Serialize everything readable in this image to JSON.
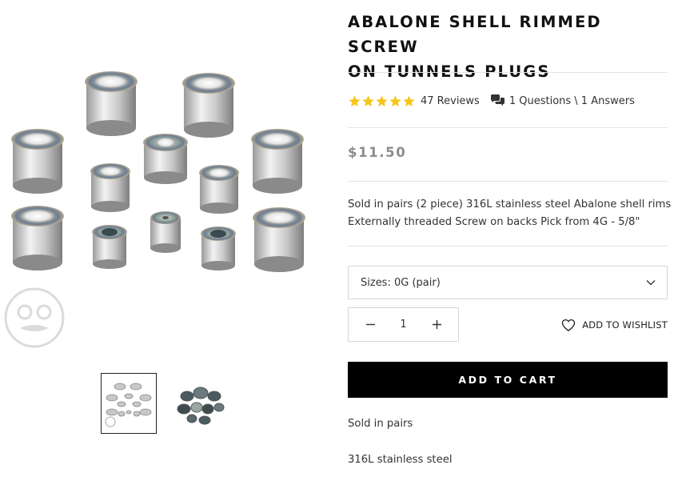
{
  "product": {
    "title_line1": "ABALONE SHELL RIMMED SCREW",
    "title_line2": "ON TUNNELS PLUGS",
    "rating": 5,
    "reviews_label": "47 Reviews",
    "qa_label": "1 Questions \\ 1 Answers",
    "price": "$11.50",
    "description_line1": "Sold in pairs (2 piece) 316L stainless steel Abalone shell rims",
    "description_line2": "Externally threaded Screw on backs Pick from 4G - 5/8\""
  },
  "options": {
    "size_label": "Sizes: 0G (pair)",
    "quantity": "1"
  },
  "actions": {
    "wishlist_label": "ADD TO WISHLIST",
    "add_to_cart_label": "ADD TO CART"
  },
  "features": [
    "Sold in pairs",
    "316L stainless steel"
  ],
  "gallery": {
    "thumbnail_count": 2,
    "active_thumbnail": 1
  },
  "colors": {
    "star": "#f5c518",
    "button_bg": "#000000",
    "price": "#8c8c8c",
    "divider": "#e3e3e3"
  },
  "icons": {
    "star": "star-icon",
    "questions": "chat-bubbles-icon",
    "dropdown": "chevron-down-icon",
    "minus": "minus-icon",
    "plus": "plus-icon",
    "wishlist": "heart-outline-icon"
  }
}
